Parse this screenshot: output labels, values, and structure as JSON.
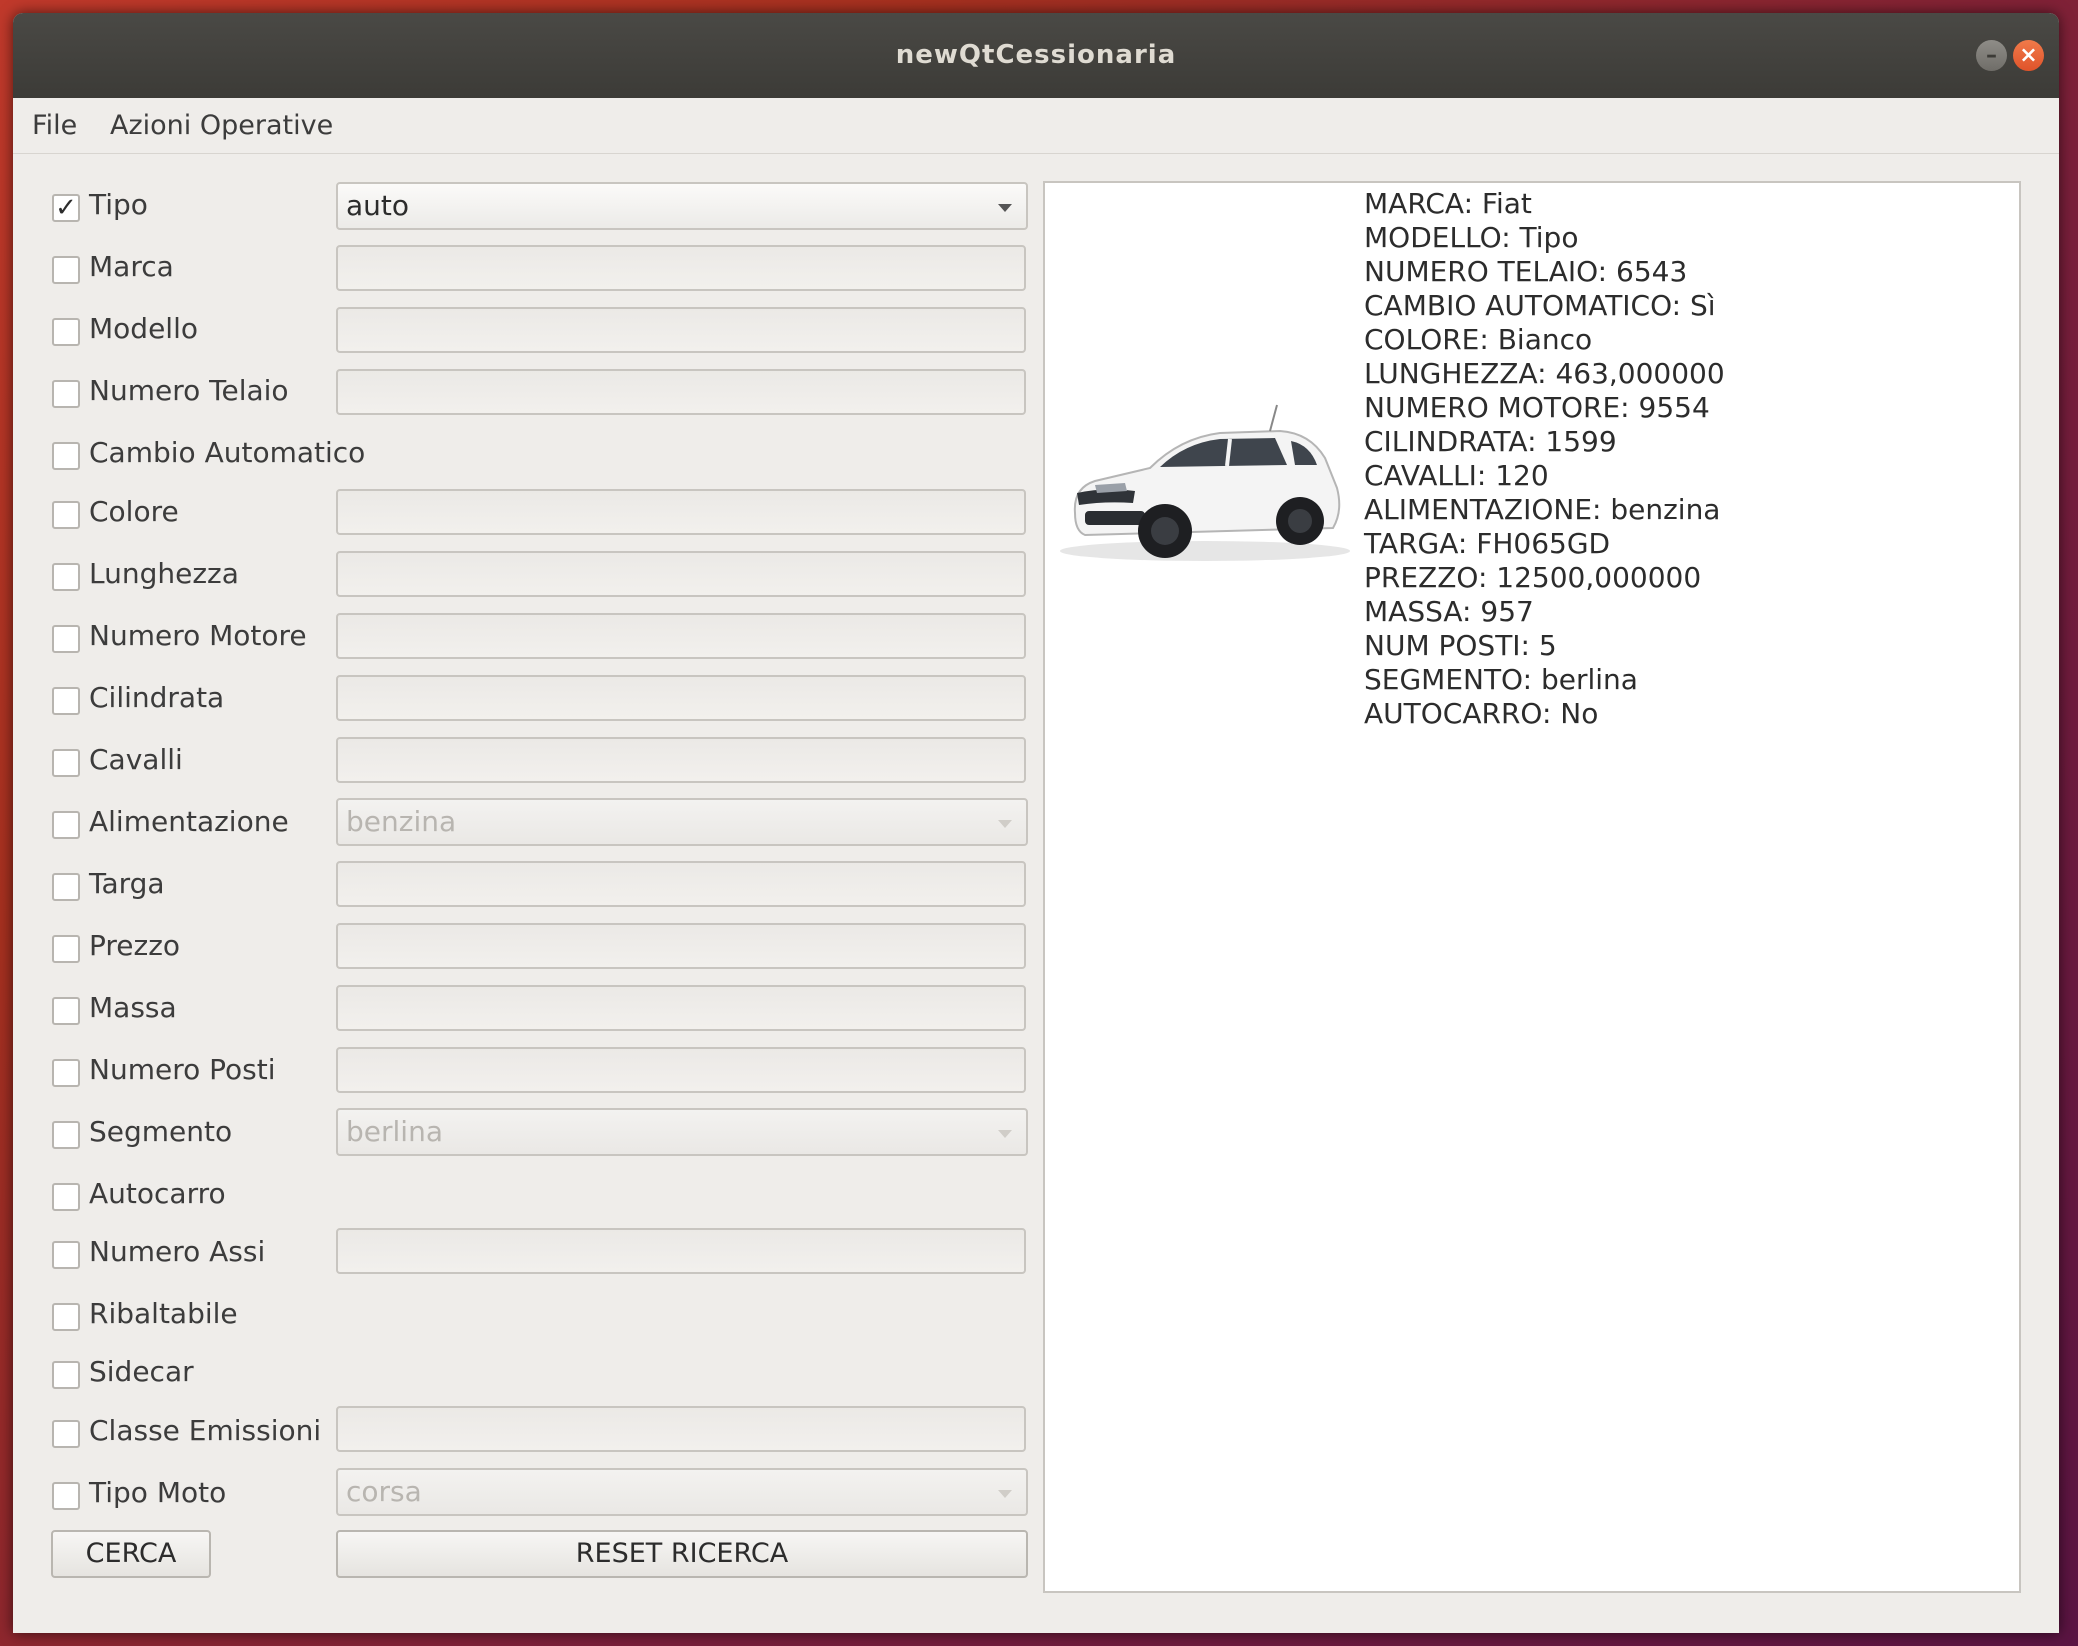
{
  "window": {
    "title": "newQtCessionaria"
  },
  "menu": {
    "items": [
      "File",
      "Azioni Operative"
    ]
  },
  "filters": [
    {
      "label": "Tipo",
      "checked": true,
      "control": "combo",
      "value": "auto",
      "enabled": true
    },
    {
      "label": "Marca",
      "checked": false,
      "control": "text",
      "value": ""
    },
    {
      "label": "Modello",
      "checked": false,
      "control": "text",
      "value": ""
    },
    {
      "label": "Numero Telaio",
      "checked": false,
      "control": "text",
      "value": ""
    },
    {
      "label": "Cambio Automatico",
      "checked": false,
      "control": "none"
    },
    {
      "label": "Colore",
      "checked": false,
      "control": "text",
      "value": ""
    },
    {
      "label": "Lunghezza",
      "checked": false,
      "control": "text",
      "value": ""
    },
    {
      "label": "Numero Motore",
      "checked": false,
      "control": "text",
      "value": ""
    },
    {
      "label": "Cilindrata",
      "checked": false,
      "control": "text",
      "value": ""
    },
    {
      "label": "Cavalli",
      "checked": false,
      "control": "text",
      "value": ""
    },
    {
      "label": "Alimentazione",
      "checked": false,
      "control": "combo",
      "value": "benzina",
      "enabled": false
    },
    {
      "label": "Targa",
      "checked": false,
      "control": "text",
      "value": ""
    },
    {
      "label": "Prezzo",
      "checked": false,
      "control": "text",
      "value": ""
    },
    {
      "label": "Massa",
      "checked": false,
      "control": "text",
      "value": ""
    },
    {
      "label": "Numero Posti",
      "checked": false,
      "control": "text",
      "value": ""
    },
    {
      "label": "Segmento",
      "checked": false,
      "control": "combo",
      "value": "berlina",
      "enabled": false
    },
    {
      "label": "Autocarro",
      "checked": false,
      "control": "none"
    },
    {
      "label": "Numero Assi",
      "checked": false,
      "control": "text",
      "value": ""
    },
    {
      "label": "Ribaltabile",
      "checked": false,
      "control": "none"
    },
    {
      "label": "Sidecar",
      "checked": false,
      "control": "none"
    },
    {
      "label": "Classe Emissioni",
      "checked": false,
      "control": "text",
      "value": ""
    },
    {
      "label": "Tipo Moto",
      "checked": false,
      "control": "combo",
      "value": "corsa",
      "enabled": false
    }
  ],
  "buttons": {
    "search": "CERCA",
    "reset": "RESET RICERCA"
  },
  "details": {
    "image_icon": "car-photo-white-fiat-tipo",
    "lines": [
      "MARCA: Fiat",
      "MODELLO: Tipo",
      "NUMERO TELAIO: 6543",
      "CAMBIO AUTOMATICO: Sì",
      "COLORE: Bianco",
      "LUNGHEZZA: 463,000000",
      "NUMERO MOTORE: 9554",
      "CILINDRATA: 1599",
      "CAVALLI: 120",
      "ALIMENTAZIONE: benzina",
      "TARGA: FH065GD",
      "PREZZO: 12500,000000",
      "MASSA: 957",
      "NUM POSTI: 5",
      "SEGMENTO: berlina",
      "AUTOCARRO: No"
    ]
  },
  "colors": {
    "window_bg": "#efedea",
    "titlebar": "#3c3b37",
    "close_button": "#e0532a",
    "panel_bg": "#ffffff"
  }
}
